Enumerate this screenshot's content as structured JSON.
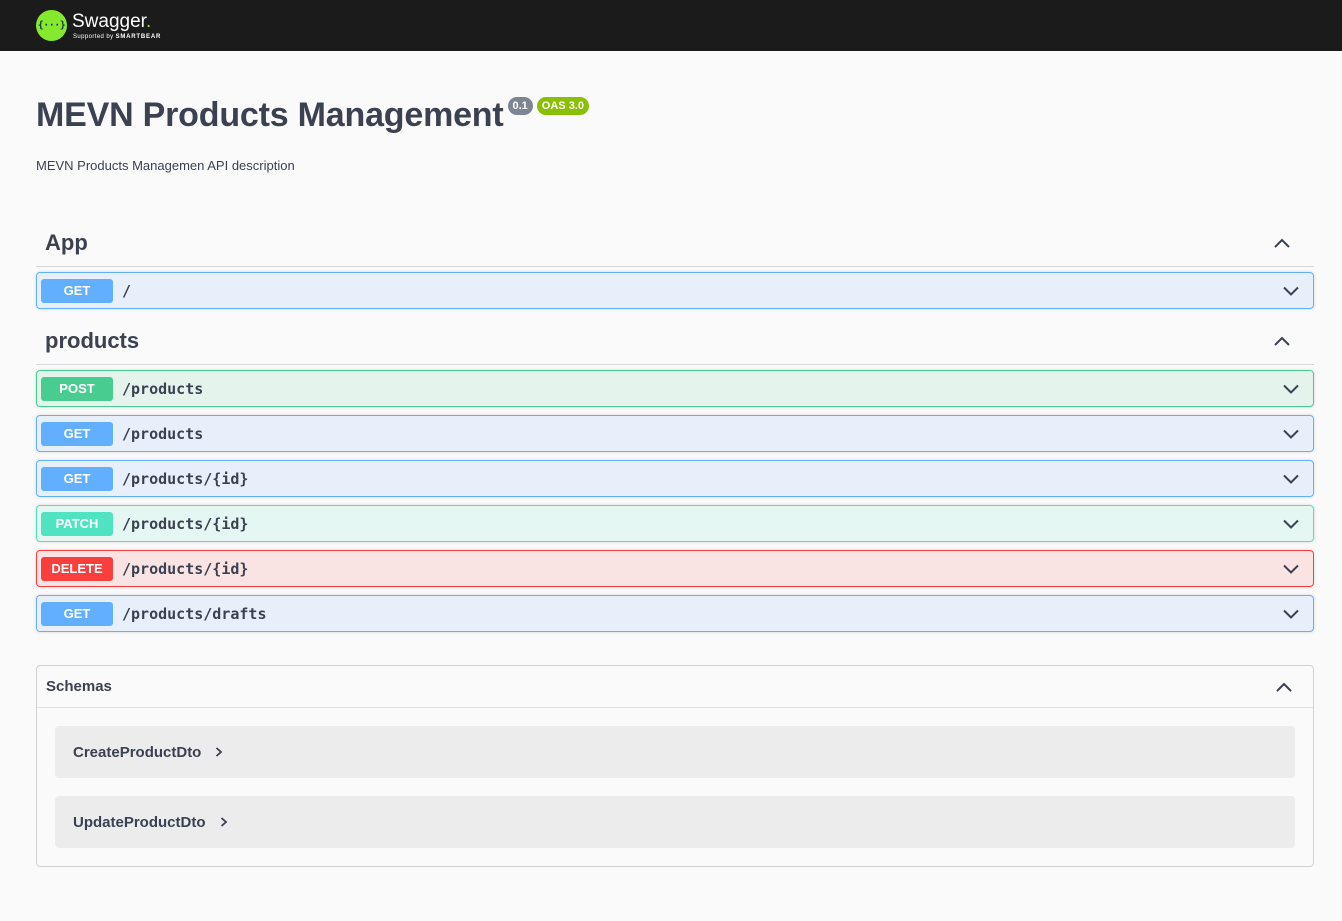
{
  "topbar": {
    "logo_glyph": "{···}",
    "brand_name": "Swagger",
    "brand_dot": ".",
    "brand_sub_prefix": "Supported by ",
    "brand_sub_company": "SMARTBEAR"
  },
  "info": {
    "title": "MEVN Products Management",
    "version": "0.1",
    "oas": "OAS 3.0",
    "description": "MEVN Products Managemen API description"
  },
  "tags": [
    {
      "name": "App",
      "operations": [
        {
          "method": "GET",
          "path": "/"
        }
      ]
    },
    {
      "name": "products",
      "operations": [
        {
          "method": "POST",
          "path": "/products"
        },
        {
          "method": "GET",
          "path": "/products"
        },
        {
          "method": "GET",
          "path": "/products/{id}"
        },
        {
          "method": "PATCH",
          "path": "/products/{id}"
        },
        {
          "method": "DELETE",
          "path": "/products/{id}"
        },
        {
          "method": "GET",
          "path": "/products/drafts"
        }
      ]
    }
  ],
  "schemas": {
    "title": "Schemas",
    "models": [
      "CreateProductDto",
      "UpdateProductDto"
    ]
  },
  "colors": {
    "get": "#61affe",
    "post": "#49cc90",
    "patch": "#50e3c2",
    "delete": "#f93e3e",
    "brand_green": "#85ea2d",
    "version_badge": "#7d8492",
    "oas_badge": "#89bf04"
  },
  "icons": {
    "section_toggle": "chevron-up-icon",
    "operation_toggle": "chevron-down-icon",
    "model_expand": "chevron-right-icon"
  }
}
